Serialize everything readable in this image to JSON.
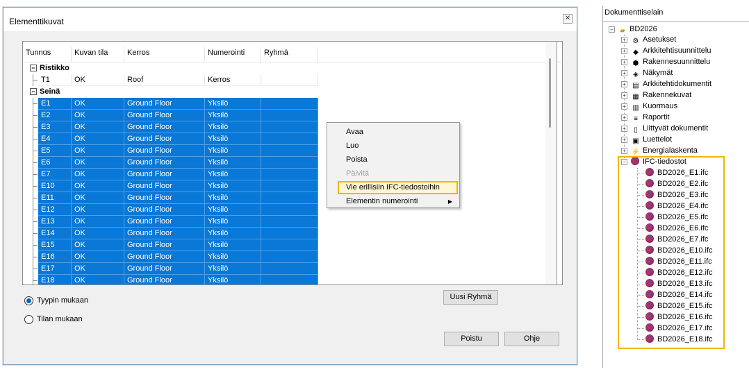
{
  "dialog": {
    "title": "Elementtikuvat",
    "close_symbol": "✕",
    "columns": [
      "Tunnus",
      "Kuvan tila",
      "Kerros",
      "Numerointi",
      "Ryhmä"
    ],
    "groups": [
      {
        "label": "Ristikko",
        "rows": [
          [
            "T1",
            "OK",
            "Roof",
            "Kerros"
          ]
        ]
      },
      {
        "label": "Seinä",
        "rows": [
          [
            "E1",
            "OK",
            "Ground Floor",
            "Yksilö"
          ],
          [
            "E2",
            "OK",
            "Ground Floor",
            "Yksilö"
          ],
          [
            "E3",
            "OK",
            "Ground Floor",
            "Yksilö"
          ],
          [
            "E4",
            "OK",
            "Ground Floor",
            "Yksilö"
          ],
          [
            "E5",
            "OK",
            "Ground Floor",
            "Yksilö"
          ],
          [
            "E6",
            "OK",
            "Ground Floor",
            "Yksilö"
          ],
          [
            "E7",
            "OK",
            "Ground Floor",
            "Yksilö"
          ],
          [
            "E10",
            "OK",
            "Ground Floor",
            "Yksilö"
          ],
          [
            "E11",
            "OK",
            "Ground Floor",
            "Yksilö"
          ],
          [
            "E12",
            "OK",
            "Ground Floor",
            "Yksilö"
          ],
          [
            "E13",
            "OK",
            "Ground Floor",
            "Yksilö"
          ],
          [
            "E14",
            "OK",
            "Ground Floor",
            "Yksilö"
          ],
          [
            "E15",
            "OK",
            "Ground Floor",
            "Yksilö"
          ],
          [
            "E16",
            "OK",
            "Ground Floor",
            "Yksilö"
          ],
          [
            "E17",
            "OK",
            "Ground Floor",
            "Yksilö"
          ],
          [
            "E18",
            "OK",
            "Ground Floor",
            "Yksilö"
          ]
        ]
      }
    ],
    "context_menu": [
      {
        "label": "Avaa",
        "disabled": false
      },
      {
        "label": "Luo",
        "disabled": false
      },
      {
        "label": "Poista",
        "disabled": false
      },
      {
        "label": "Päivitä",
        "disabled": true
      },
      {
        "label": "Vie erillisiin IFC-tiedostoihin",
        "disabled": false,
        "highlighted": true
      },
      {
        "label": "Elementin numerointi",
        "disabled": false,
        "submenu": true
      }
    ],
    "new_group_button": "Uusi Ryhmä",
    "radio_options": [
      {
        "label": "Tyypin mukaan",
        "selected": true
      },
      {
        "label": "Tilan mukaan",
        "selected": false
      }
    ],
    "exit_button": "Poistu",
    "help_button": "Ohje"
  },
  "browser": {
    "title": "Dokumenttiselain",
    "root": "BD2026",
    "nodes": [
      {
        "label": "Asetukset",
        "icon": "gear-icon"
      },
      {
        "label": "Arkkitehtisuunnittelu",
        "icon": "architecture-icon"
      },
      {
        "label": "Rakennesuunnittelu",
        "icon": "structure-icon"
      },
      {
        "label": "Näkymät",
        "icon": "views-icon"
      },
      {
        "label": "Arkkitehtidokumentit",
        "icon": "arch-docs-icon"
      },
      {
        "label": "Rakennekuvat",
        "icon": "structure-drawings-icon"
      },
      {
        "label": "Kuormaus",
        "icon": "load-icon"
      },
      {
        "label": "Raportit",
        "icon": "reports-icon"
      },
      {
        "label": "Liittyvät dokumentit",
        "icon": "document-icon"
      },
      {
        "label": "Luettelot",
        "icon": "lists-icon"
      },
      {
        "label": "Energialaskenta",
        "icon": "energy-icon"
      }
    ],
    "ifc_folder": "IFC-tiedostot",
    "ifc_files": [
      "BD2026_E1.ifc",
      "BD2026_E2.ifc",
      "BD2026_E3.ifc",
      "BD2026_E4.ifc",
      "BD2026_E5.ifc",
      "BD2026_E6.ifc",
      "BD2026_E7.ifc",
      "BD2026_E10.ifc",
      "BD2026_E11.ifc",
      "BD2026_E12.ifc",
      "BD2026_E13.ifc",
      "BD2026_E14.ifc",
      "BD2026_E15.ifc",
      "BD2026_E16.ifc",
      "BD2026_E17.ifc",
      "BD2026_E18.ifc"
    ]
  },
  "colors": {
    "selection": "#0a78d7",
    "highlight": "#f5b400"
  }
}
